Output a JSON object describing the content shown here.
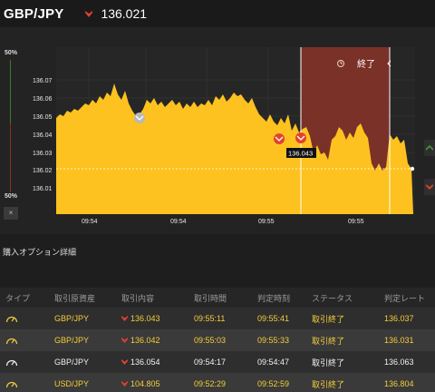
{
  "header": {
    "pair": "GBP/JPY",
    "rate": "136.021",
    "direction_icon": "down-arrow-red"
  },
  "chart": {
    "y_ticks": [
      "136.07",
      "136.06",
      "136.05",
      "136.04",
      "136.03",
      "136.02",
      "136.01"
    ],
    "x_ticks": [
      "09:54",
      "09:54",
      "09:55",
      "09:55"
    ],
    "end_label": "終了",
    "end_icon": "clock-icon",
    "price_tag": "136.043",
    "gauge_top": "50%",
    "gauge_bottom": "50%",
    "gauge_close": "×",
    "colors": {
      "area": "#fdc21f",
      "end_zone": "#7a3128",
      "up": "#4aa33a",
      "down": "#d8412d"
    }
  },
  "section_title": "購入オプション詳細",
  "table": {
    "headers": [
      "タイプ",
      "取引原資産",
      "取引内容",
      "取引時間",
      "判定時刻",
      "ステータス",
      "判定レート"
    ],
    "rows": [
      {
        "asset": "GBP/JPY",
        "content": "136.043",
        "time": "09:55:11",
        "judge_time": "09:55:41",
        "status": "取引終了",
        "rate": "136.037",
        "color": "yellow"
      },
      {
        "asset": "GBP/JPY",
        "content": "136.042",
        "time": "09:55:03",
        "judge_time": "09:55:33",
        "status": "取引終了",
        "rate": "136.031",
        "color": "yellow"
      },
      {
        "asset": "GBP/JPY",
        "content": "136.054",
        "time": "09:54:17",
        "judge_time": "09:54:47",
        "status": "取引終了",
        "rate": "136.063",
        "color": "white"
      },
      {
        "asset": "USD/JPY",
        "content": "104.805",
        "time": "09:52:29",
        "judge_time": "09:52:59",
        "status": "取引終了",
        "rate": "136.804",
        "color": "yellow"
      }
    ]
  }
}
